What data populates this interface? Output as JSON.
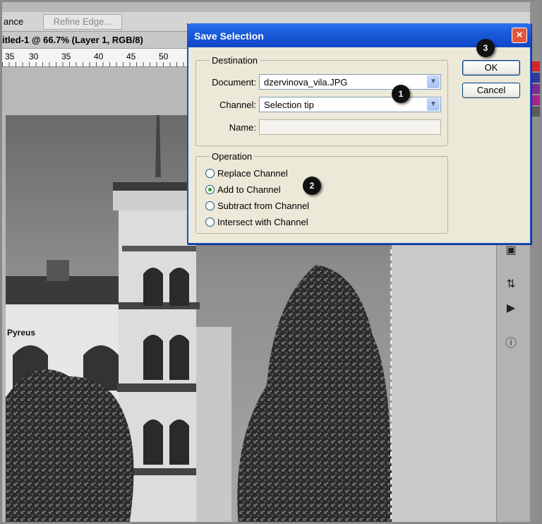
{
  "options_bar": {
    "label": "ance",
    "refine_edge": "Refine Edge..."
  },
  "document_tab": {
    "title": "itled-1 @ 66.7% (Layer 1, RGB/8)"
  },
  "ruler": {
    "ticks": [
      "35",
      "30",
      "35",
      "40",
      "45",
      "50"
    ]
  },
  "photo": {
    "sign_text": "Pyreus"
  },
  "dialog": {
    "title": "Save Selection",
    "close": "×",
    "destination": {
      "legend": "Destination",
      "document_label": "Document:",
      "document_value": "dzervinova_vila.JPG",
      "channel_label": "Channel:",
      "channel_value": "Selection tip",
      "name_label": "Name:",
      "name_value": ""
    },
    "operation": {
      "legend": "Operation",
      "options": [
        "Replace Channel",
        "Add to Channel",
        "Subtract from Channel",
        "Intersect with Channel"
      ],
      "selected": "Add to Channel"
    },
    "ok": "OK",
    "cancel": "Cancel"
  },
  "badges": {
    "one": "1",
    "two": "2",
    "three": "3"
  },
  "colors": {
    "title_bar": "#1a5bd8",
    "dialog_bg": "#ece9d8",
    "badge": "#111111"
  },
  "icons": [
    "refine-edge",
    "close-icon",
    "chevron-down-icon",
    "info-icon",
    "play-icon"
  ]
}
